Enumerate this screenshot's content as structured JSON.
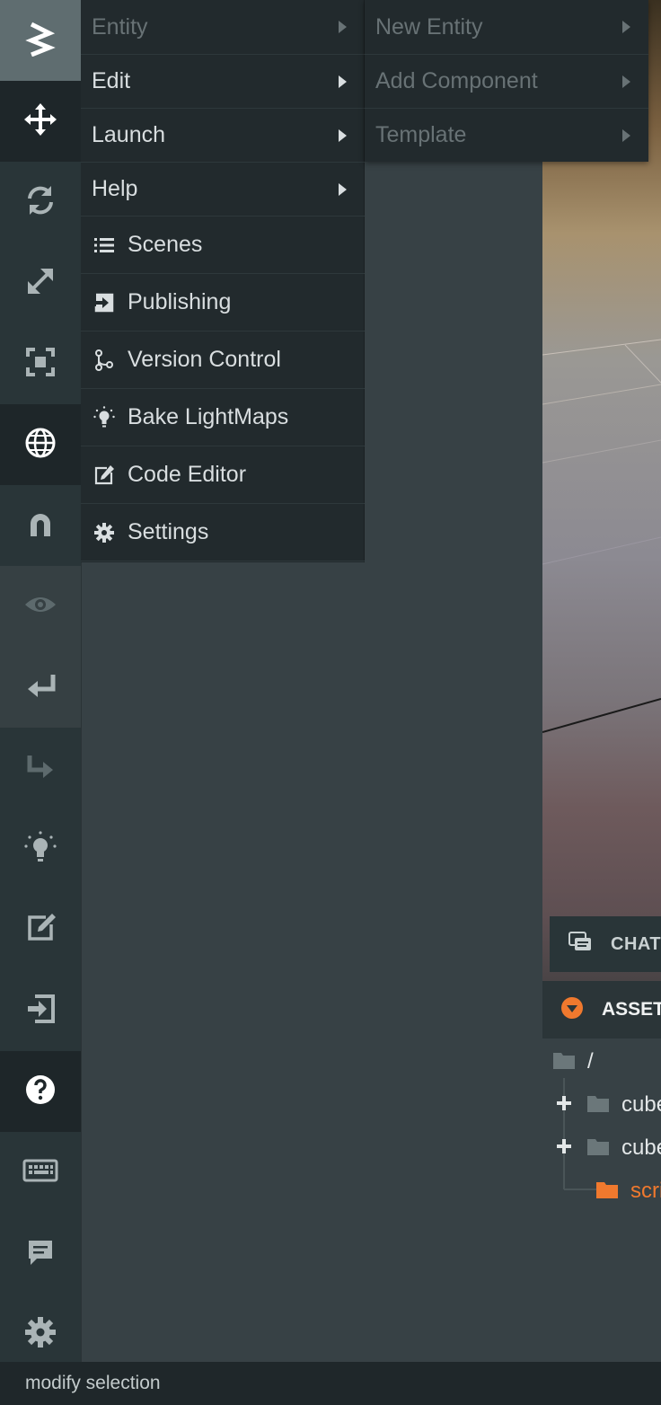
{
  "main_menu": {
    "items": [
      {
        "label": "Entity",
        "has_submenu": true,
        "disabled": true
      },
      {
        "label": "Edit",
        "has_submenu": true,
        "disabled": false
      },
      {
        "label": "Launch",
        "has_submenu": true,
        "disabled": false
      },
      {
        "label": "Help",
        "has_submenu": true,
        "disabled": false
      },
      {
        "label": "Scenes",
        "icon": "list-icon"
      },
      {
        "label": "Publishing",
        "icon": "publish-icon"
      },
      {
        "label": "Version Control",
        "icon": "branch-icon"
      },
      {
        "label": "Bake LightMaps",
        "icon": "lightbulb-icon"
      },
      {
        "label": "Code Editor",
        "icon": "code-editor-icon"
      },
      {
        "label": "Settings",
        "icon": "gear-icon"
      }
    ]
  },
  "sub_menu": {
    "items": [
      {
        "label": "New Entity",
        "disabled": true
      },
      {
        "label": "Add Component",
        "disabled": true
      },
      {
        "label": "Template",
        "disabled": true
      }
    ]
  },
  "toolbar": {
    "items": [
      {
        "name": "logo-icon"
      },
      {
        "name": "translate-icon"
      },
      {
        "name": "rotate-icon"
      },
      {
        "name": "scale-icon"
      },
      {
        "name": "resize-icon"
      },
      {
        "name": "world-icon"
      },
      {
        "name": "magnet-icon"
      },
      {
        "name": "eye-icon"
      },
      {
        "name": "undo-icon"
      },
      {
        "name": "redo-icon"
      },
      {
        "name": "lightbulb-icon"
      },
      {
        "name": "code-editor-icon"
      },
      {
        "name": "publish-icon"
      },
      {
        "name": "help-icon"
      },
      {
        "name": "keyboard-icon"
      },
      {
        "name": "chat-icon"
      },
      {
        "name": "settings-icon"
      }
    ]
  },
  "chat": {
    "label": "CHAT"
  },
  "assets": {
    "title": "ASSETS",
    "tree": [
      {
        "label": "/",
        "type": "root"
      },
      {
        "label": "cube",
        "type": "folder",
        "expandable": true
      },
      {
        "label": "cube",
        "type": "folder",
        "expandable": true
      },
      {
        "label": "scripts",
        "type": "folder",
        "highlighted": true
      }
    ]
  },
  "status": {
    "text": "modify selection"
  },
  "colors": {
    "accent": "#f0792e",
    "toolbar_bg": "#293538",
    "menu_bg": "#222a2d"
  }
}
